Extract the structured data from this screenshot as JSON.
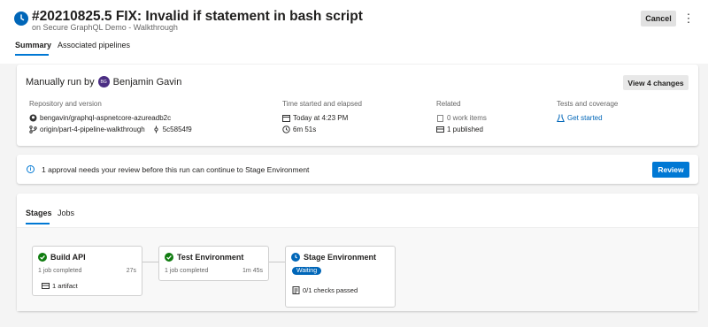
{
  "header": {
    "title": "#20210825.5 FIX: Invalid if statement in bash script",
    "subtitle": "on Secure GraphQL Demo - Walkthrough",
    "cancel_label": "Cancel",
    "more_label": "⋮"
  },
  "tabs": [
    {
      "label": "Summary",
      "active": true
    },
    {
      "label": "Associated pipelines",
      "active": false
    }
  ],
  "summary": {
    "manual_prefix": "Manually run by",
    "user_initials": "BG",
    "user_name": "Benjamin Gavin",
    "view_changes_label": "View 4 changes",
    "repo": {
      "header": "Repository and version",
      "repo_name": "bengavin/graphql-aspnetcore-azureadb2c",
      "branch": "origin/part-4-pipeline-walkthrough",
      "commit": "5c5854f9"
    },
    "time": {
      "header": "Time started and elapsed",
      "started": "Today at 4:23 PM",
      "elapsed": "6m 51s"
    },
    "related": {
      "header": "Related",
      "work_items": "0 work items",
      "published": "1 published"
    },
    "tests": {
      "header": "Tests and coverage",
      "link": "Get started"
    }
  },
  "approval": {
    "icon": "i",
    "message": "1 approval needs your review before this run can continue to Stage Environment",
    "review_label": "Review"
  },
  "stages_tabs": [
    {
      "label": "Stages",
      "active": true
    },
    {
      "label": "Jobs",
      "active": false
    }
  ],
  "stages": [
    {
      "name": "Build API",
      "status": "succeeded",
      "jobs": "1 job completed",
      "duration": "27s",
      "extra": "1 artifact"
    },
    {
      "name": "Test Environment",
      "status": "succeeded",
      "jobs": "1 job completed",
      "duration": "1m 45s"
    },
    {
      "name": "Stage Environment",
      "status": "waiting",
      "badge": "Waiting",
      "extra": "0/1 checks passed"
    }
  ],
  "colors": {
    "accent": "#0078d4",
    "success": "#107c10",
    "waiting": "#0066b8"
  }
}
